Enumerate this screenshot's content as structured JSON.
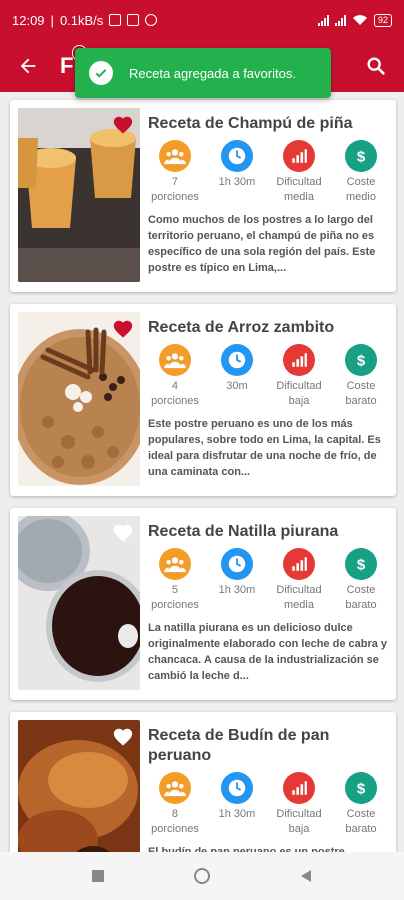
{
  "status_bar": {
    "time": "12:09",
    "net_speed": "0.1kB/s",
    "battery": "92"
  },
  "app_bar": {
    "title": "F",
    "badge": "2"
  },
  "toast": {
    "message": "Receta agregada a favoritos."
  },
  "recipes": [
    {
      "title": "Receta de Champú de piña",
      "favorite": true,
      "portions": "7\nporciones",
      "time": "1h 30m",
      "difficulty": "Dificultad\nmedia",
      "cost": "Coste\nmedio",
      "description": "Como muchos de los postres a lo largo del territorio peruano, el champú de piña no es específico de una sola región del país. Este postre es típico en Lima,..."
    },
    {
      "title": "Receta de Arroz zambito",
      "favorite": true,
      "portions": "4\nporciones",
      "time": "30m",
      "difficulty": "Dificultad\nbaja",
      "cost": "Coste\nbarato",
      "description": "Este postre peruano es uno de los más populares, sobre todo en Lima, la capital. Es ideal para disfrutar de una noche de frío, de una caminata con..."
    },
    {
      "title": "Receta de Natilla piurana",
      "favorite": false,
      "portions": "5\nporciones",
      "time": "1h 30m",
      "difficulty": "Dificultad\nmedia",
      "cost": "Coste\nbarato",
      "description": "La natilla piurana es un delicioso dulce originalmente elaborado con leche de cabra y chancaca. A causa de la industrialización se cambió la leche d..."
    },
    {
      "title": "Receta de Budín de pan peruano",
      "favorite": false,
      "portions": "8\nporciones",
      "time": "1h 30m",
      "difficulty": "Dificultad\nbaja",
      "cost": "Coste\nbarato",
      "description": "El budín de pan peruano es un postre"
    }
  ],
  "colors": {
    "primary": "#c8102e",
    "toast": "#22b14c",
    "portions_icon": "#f39c2a",
    "time_icon": "#2196f3",
    "difficulty_icon": "#e53935",
    "cost_icon": "#18a085"
  },
  "icons": {
    "portions": "group-icon",
    "time": "clock-icon",
    "difficulty": "bar-chart-icon",
    "cost": "dollar-icon",
    "favorite": "heart-icon"
  }
}
